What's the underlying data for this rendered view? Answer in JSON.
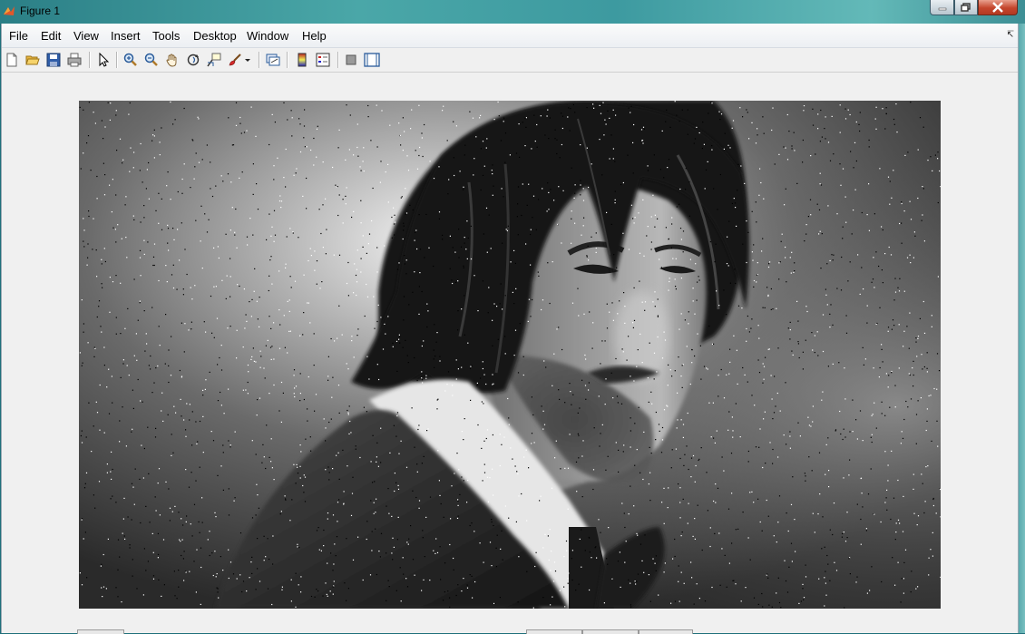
{
  "window": {
    "title": "Figure 1"
  },
  "menu": {
    "items": [
      {
        "id": "file",
        "label": "File"
      },
      {
        "id": "edit",
        "label": "Edit"
      },
      {
        "id": "view",
        "label": "View"
      },
      {
        "id": "insert",
        "label": "Insert"
      },
      {
        "id": "tools",
        "label": "Tools"
      },
      {
        "id": "desktop",
        "label": "Desktop"
      },
      {
        "id": "window",
        "label": "Window"
      },
      {
        "id": "help",
        "label": "Help"
      }
    ]
  },
  "toolbar": {
    "buttons": [
      "new-figure-icon",
      "open-file-icon",
      "save-icon",
      "print-icon",
      "edit-plot-pointer-icon",
      "zoom-in-icon",
      "zoom-out-icon",
      "pan-hand-icon",
      "rotate-3d-icon",
      "data-cursor-icon",
      "brush-icon",
      "link-plot-icon",
      "insert-colorbar-icon",
      "insert-legend-icon",
      "hide-plot-tools-icon",
      "show-plot-tools-icon"
    ]
  },
  "figure": {
    "content": "grayscale photo of a man with long dark hair and beard in a dark suit, with salt-and-pepper noise"
  },
  "colors": {
    "titlebar": "#3d9aa0",
    "client_bg": "#f0f0f0",
    "close_button": "#c4452c"
  }
}
